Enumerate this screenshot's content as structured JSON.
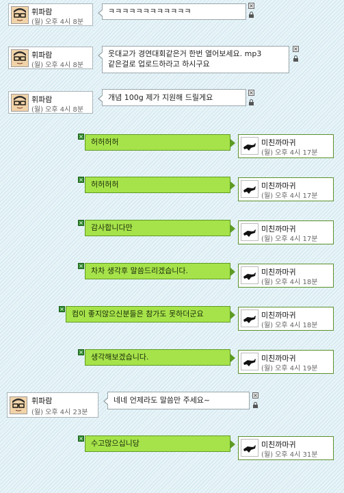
{
  "messages": [
    {
      "side": "gray",
      "name": "휘파람",
      "time": "(월) 오후 4시 8분",
      "lines": [
        "ㅋㅋㅋㅋㅋㅋㅋㅋㅋㅋㅋㅋ"
      ]
    },
    {
      "side": "gray",
      "name": "휘파람",
      "time": "(월) 오후 4시 8분",
      "lines": [
        "웃대교가 경연대회같은거 한번 열어보세요. mp3",
        "같은걸로 업로드하라고 하시구요"
      ]
    },
    {
      "side": "gray",
      "name": "휘파람",
      "time": "(월) 오후 4시 8분",
      "lines": [
        "개념 100g 제가 지원해 드릴게요"
      ]
    },
    {
      "side": "green",
      "name": "미친까마귀",
      "time": "(월) 오후 4시 17분",
      "lines": [
        "허허허허"
      ]
    },
    {
      "side": "green",
      "name": "미친까마귀",
      "time": "(월) 오후 4시 17분",
      "lines": [
        "허허허허"
      ]
    },
    {
      "side": "green",
      "name": "미친까마귀",
      "time": "(월) 오후 4시 17분",
      "lines": [
        "감사합니다만"
      ]
    },
    {
      "side": "green",
      "name": "미친까마귀",
      "time": "(월) 오후 4시 18분",
      "lines": [
        "차차 생각후 말씀드리겠습니다."
      ]
    },
    {
      "side": "green",
      "name": "미친까마귀",
      "time": "(월) 오후 4시 18분",
      "lines": [
        "컴이 좋지않으신분들은 참가도 못하더군요"
      ]
    },
    {
      "side": "green",
      "name": "미친까마귀",
      "time": "(월) 오후 4시 19분",
      "lines": [
        "생각해보겠습니다."
      ]
    },
    {
      "side": "gray",
      "name": "휘파람",
      "time": "(월) 오후 4시 23분",
      "lines": [
        "네네 언제라도 말씀만 주세요~"
      ]
    },
    {
      "side": "green",
      "name": "미친까마귀",
      "time": "(월) 오후 4시 31분",
      "lines": [
        "수고많으십니당"
      ]
    }
  ],
  "icons": {
    "close": "close-icon",
    "lock": "lock-icon",
    "avatar_left": "glasses-man-avatar",
    "avatar_right": "crow-avatar"
  },
  "colors": {
    "green_bubble": "#a6e34a",
    "green_border": "#5d9b23",
    "gray_border": "#9aa6aa",
    "background": "#e8f4f8"
  }
}
